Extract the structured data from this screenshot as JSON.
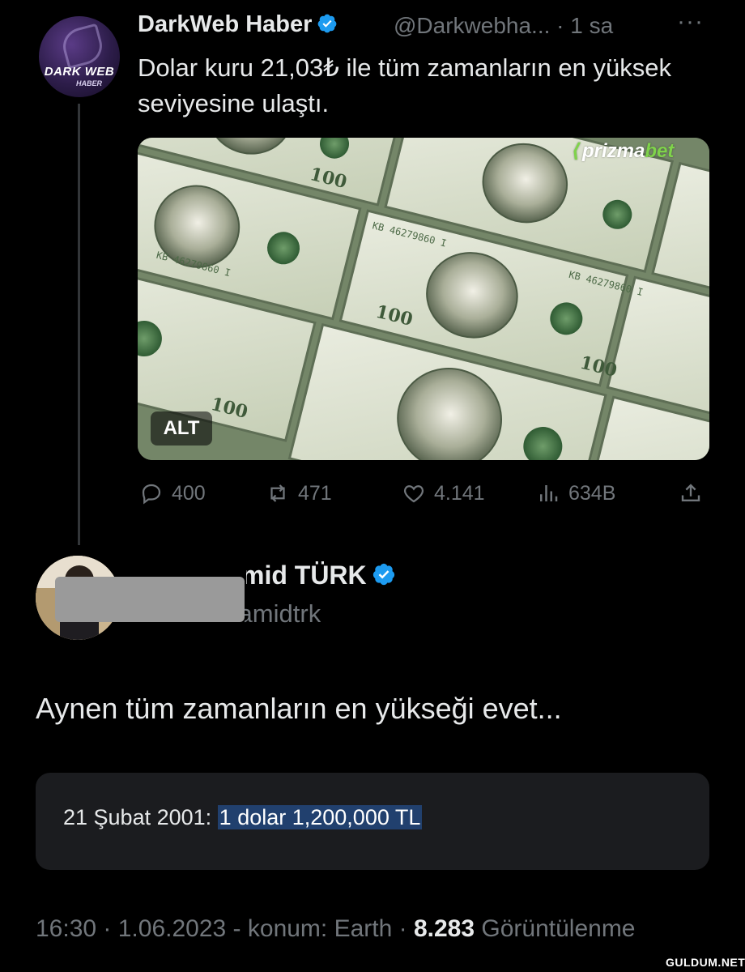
{
  "tweet": {
    "author_name": "DarkWeb Haber",
    "author_handle": "@Darkwebha...",
    "time_sep": "·",
    "time": "1 sa",
    "more": "···",
    "avatar_text_top": "DARK WEB",
    "avatar_text_bottom": "HABER",
    "text": "Dolar kuru 21,03₺ ile tüm zamanların en yüksek seviyesine ulaştı.",
    "media_alt_label": "ALT",
    "watermark": {
      "brand": "prizma",
      "brand_accent": "bet"
    },
    "banknote_serial": "KB 46279860 I",
    "banknote_denomination": "100",
    "actions": {
      "replies": "400",
      "reposts": "471",
      "likes": "4.141",
      "views": "634B"
    }
  },
  "reply": {
    "author_name_visible": "Abdülhamid TÜRK",
    "author_handle_visible": "@abdulhamidtrk",
    "text": "Aynen tüm zamanların en yükseği evet...",
    "card": {
      "prefix": "21 Şubat 2001: ",
      "highlight": "1 dolar 1,200,000 TL"
    },
    "footer": {
      "time": "16:30",
      "sep1": " · ",
      "date": "1.06.2023",
      "location": " - konum: Earth",
      "sep2": " · ",
      "views_count": "8.283",
      "views_label": " Görüntülenme"
    }
  },
  "site_watermark": "GULDUM.NET",
  "colors": {
    "background": "#000000",
    "primary_text": "#e7e9ea",
    "secondary_text": "#71767b",
    "verified_blue": "#1d9bf0",
    "highlight": "#21406e",
    "card_bg": "#1b1c1f",
    "watermark_green": "#7fd34b"
  },
  "icons": [
    "verified-icon",
    "reply-icon",
    "repost-icon",
    "like-icon",
    "views-icon",
    "share-icon",
    "more-icon"
  ]
}
